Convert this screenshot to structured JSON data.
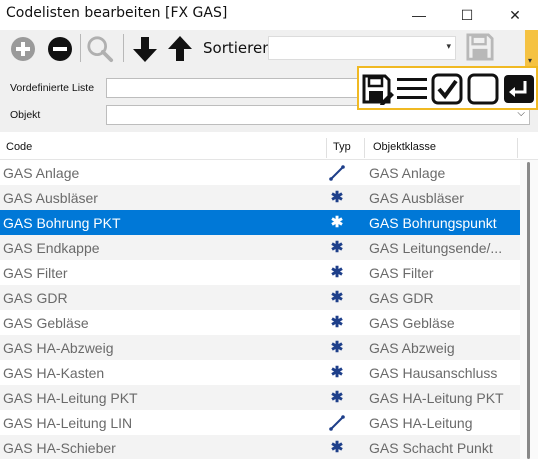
{
  "window": {
    "title": "Codelisten bearbeiten [FX GAS]",
    "minimize_glyph": "—",
    "maximize_glyph": "☐",
    "close_glyph": "✕"
  },
  "toolbar": {
    "sort_label": "Sortieren",
    "sort_value": "",
    "icons": [
      "add-icon",
      "remove-icon",
      "search-icon",
      "arrow-down-icon",
      "arrow-up-icon",
      "save-icon"
    ]
  },
  "form": {
    "predefined_label": "Vordefinierte Liste",
    "predefined_value": "",
    "object_label": "Objekt",
    "object_value": ""
  },
  "popup_icons": [
    "save-edit-icon",
    "list-icon",
    "checkbox-checked-icon",
    "checkbox-empty-icon",
    "enter-icon"
  ],
  "table": {
    "columns": [
      "Code",
      "Typ",
      "Objektklasse"
    ],
    "rows": [
      {
        "code": "GAS Anlage",
        "typ": "line",
        "klasse": "GAS Anlage"
      },
      {
        "code": "GAS Ausbläser",
        "typ": "point",
        "klasse": "GAS Ausbläser"
      },
      {
        "code": "GAS Bohrung PKT",
        "typ": "point",
        "klasse": "GAS Bohrungspunkt",
        "selected": true
      },
      {
        "code": "GAS Endkappe",
        "typ": "point",
        "klasse": "GAS Leitungsende/..."
      },
      {
        "code": "GAS Filter",
        "typ": "point",
        "klasse": "GAS Filter"
      },
      {
        "code": "GAS GDR",
        "typ": "point",
        "klasse": "GAS GDR"
      },
      {
        "code": "GAS Gebläse",
        "typ": "point",
        "klasse": "GAS Gebläse"
      },
      {
        "code": "GAS HA-Abzweig",
        "typ": "point",
        "klasse": "GAS Abzweig"
      },
      {
        "code": "GAS HA-Kasten",
        "typ": "point",
        "klasse": "GAS Hausanschluss"
      },
      {
        "code": "GAS HA-Leitung PKT",
        "typ": "point",
        "klasse": "GAS HA-Leitung PKT"
      },
      {
        "code": "GAS HA-Leitung LIN",
        "typ": "line",
        "klasse": "GAS HA-Leitung"
      },
      {
        "code": "GAS HA-Schieber",
        "typ": "point",
        "klasse": "GAS Schacht Punkt"
      }
    ]
  },
  "colors": {
    "selection": "#0078d7",
    "accent": "#f0b923",
    "icon_dark": "#1e3f8a"
  }
}
